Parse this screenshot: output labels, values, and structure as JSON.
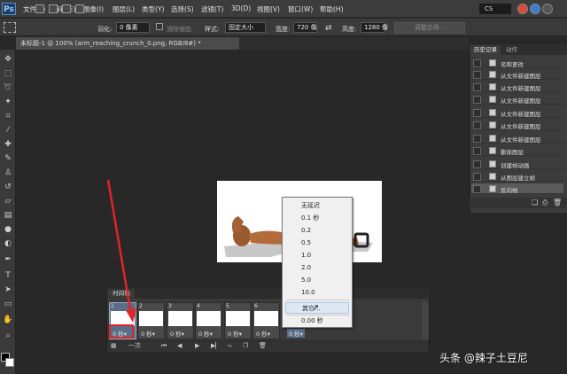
{
  "app": {
    "logo": "Ps",
    "menu": [
      "文件(F)",
      "编辑(E)",
      "图像(I)",
      "图层(L)",
      "类型(Y)",
      "选择(S)",
      "滤镜(T)",
      "3D(D)",
      "视图(V)",
      "窗口(W)",
      "帮助(H)"
    ],
    "cs_badge": "CS"
  },
  "options": {
    "feather_label": "羽化:",
    "feather_value": "0 像素",
    "antialias_label": "消除锯齿",
    "style_label": "样式:",
    "style_value": "固定大小",
    "width_label": "宽度:",
    "width_value": "720 像",
    "height_label": "高度:",
    "height_value": "1280 像",
    "refine_label": "调整边缘..."
  },
  "document": {
    "tab_title": "未标题-1 @ 100% (arm_reaching_crunch_0.png, RGB/8#) *"
  },
  "timeline": {
    "tab_label": "时间轴",
    "frames": [
      {
        "num": "1",
        "duration": "0 秒▾"
      },
      {
        "num": "2",
        "duration": "0 秒▾"
      },
      {
        "num": "3",
        "duration": "0 秒▾"
      },
      {
        "num": "4",
        "duration": "0 秒▾"
      },
      {
        "num": "5",
        "duration": "0 秒▾"
      },
      {
        "num": "6",
        "duration": "0 秒▾"
      },
      {
        "num": "",
        "duration": "0 秒▾"
      }
    ],
    "loop_value": "一次"
  },
  "dropdown": {
    "items": [
      "无延迟",
      "0.1 秒",
      "0.2",
      "0.5",
      "1.0",
      "2.0",
      "5.0",
      "10.0",
      "其它...",
      "0.00 秒"
    ],
    "hovered": "其它..."
  },
  "history": {
    "tabs": [
      "历史记录",
      "动作"
    ],
    "items": [
      "名称更改",
      "从文件新建图层",
      "从文件新建图层",
      "从文件新建图层",
      "从文件新建图层",
      "从文件新建图层",
      "从文件新建图层",
      "删除图层",
      "创建帧动画",
      "从图层建立帧",
      "反向帧"
    ],
    "selected_index": 10
  },
  "watermark": "头条 @辣子土豆尼",
  "colors": {
    "annotation_red": "#e0242a",
    "selection": "#5a6f87"
  }
}
